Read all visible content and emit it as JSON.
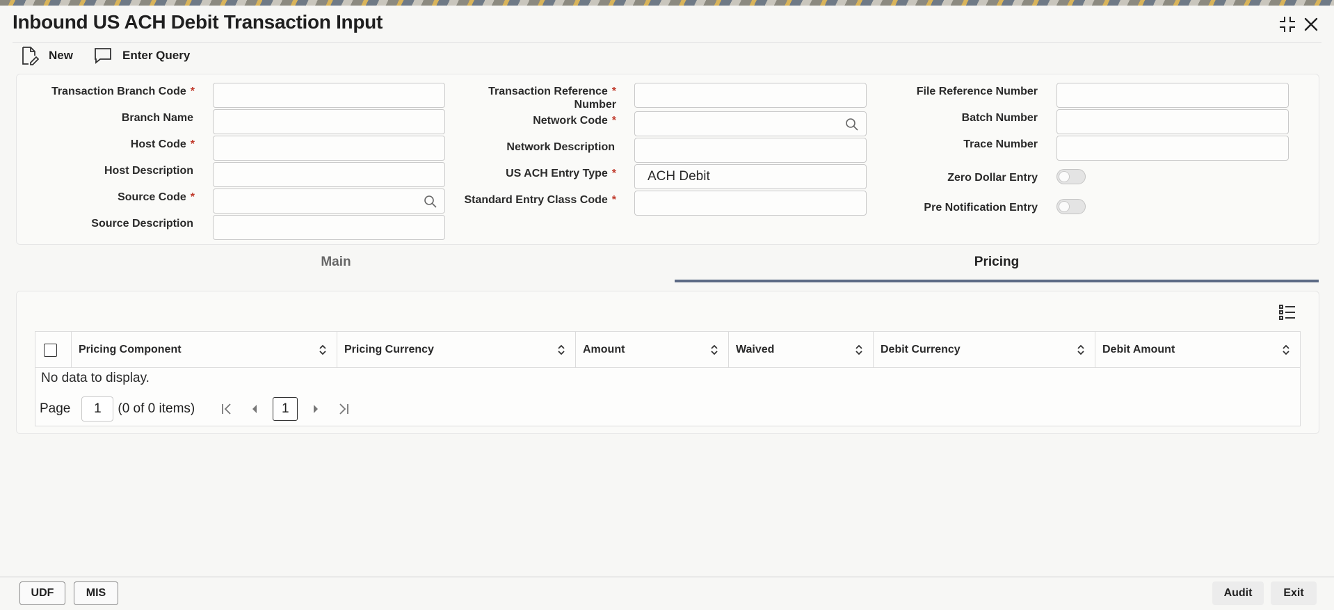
{
  "window": {
    "title": "Inbound US ACH Debit Transaction Input"
  },
  "toolbar": {
    "new_label": "New",
    "enter_query_label": "Enter Query"
  },
  "form": {
    "left": {
      "transaction_branch_code": {
        "label": "Transaction Branch Code",
        "value": ""
      },
      "branch_name": {
        "label": "Branch Name",
        "value": ""
      },
      "host_code": {
        "label": "Host Code",
        "value": ""
      },
      "host_description": {
        "label": "Host Description",
        "value": ""
      },
      "source_code": {
        "label": "Source Code",
        "value": ""
      },
      "source_description": {
        "label": "Source Description",
        "value": ""
      }
    },
    "middle": {
      "transaction_reference_number": {
        "label_line1": "Transaction Reference",
        "label_line2": "Number",
        "value": ""
      },
      "network_code": {
        "label": "Network Code",
        "value": ""
      },
      "network_description": {
        "label": "Network Description",
        "value": ""
      },
      "us_ach_entry_type": {
        "label": "US ACH Entry Type",
        "value": "ACH Debit"
      },
      "standard_entry_class_code": {
        "label": "Standard Entry Class Code",
        "value": ""
      }
    },
    "right": {
      "file_reference_number": {
        "label": "File Reference Number",
        "value": ""
      },
      "batch_number": {
        "label": "Batch Number",
        "value": ""
      },
      "trace_number": {
        "label": "Trace Number",
        "value": ""
      },
      "zero_dollar_entry": {
        "label": "Zero Dollar Entry",
        "on": false
      },
      "pre_notification_entry": {
        "label": "Pre Notification Entry",
        "on": false
      }
    },
    "required_marker": "*"
  },
  "tabs": [
    {
      "label": "Main",
      "active": false
    },
    {
      "label": "Pricing",
      "active": true
    }
  ],
  "pricing_table": {
    "columns": [
      "Pricing Component",
      "Pricing Currency",
      "Amount",
      "Waived",
      "Debit Currency",
      "Debit Amount"
    ],
    "rows": [],
    "empty_message": "No data to display.",
    "pager": {
      "page_label": "Page",
      "page_value": "1",
      "items_summary": "(0 of 0 items)",
      "current_page": "1"
    }
  },
  "footer": {
    "udf_label": "UDF",
    "mis_label": "MIS",
    "audit_label": "Audit",
    "exit_label": "Exit"
  },
  "icons": {
    "new": "new-document-icon",
    "enter_query": "speech-bubble-icon",
    "minimize": "collapse-icon",
    "close": "close-icon",
    "lookup": "search-icon",
    "sort": "sort-icon",
    "column_settings": "column-list-icon"
  },
  "colors": {
    "tab_underline": "#5d6b85",
    "required": "#c0392b"
  }
}
